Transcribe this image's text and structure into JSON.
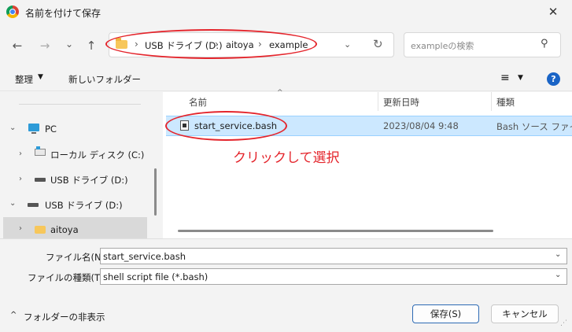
{
  "window": {
    "title": "名前を付けて保存",
    "close": "✕"
  },
  "nav": {
    "back": "←",
    "forward": "→",
    "recent": "⌄",
    "up": "↑",
    "breadcrumbs": [
      "USB ドライブ (D:)",
      "aitoya",
      "example"
    ],
    "separator": "›",
    "dropdown": "⌄",
    "refresh": "↻",
    "search_placeholder": "exampleの検索",
    "search_icon": "⚲"
  },
  "toolbar": {
    "organize": "整理",
    "caret": "▼",
    "new_folder": "新しいフォルダー",
    "view_icon": "≡",
    "help": "?"
  },
  "tree": {
    "pc": "PC",
    "local_disk": "ローカル ディスク (C:)",
    "usb1": "USB ドライブ (D:)",
    "usb2": "USB ドライブ (D:)",
    "aitoya": "aitoya",
    "collapsed": "›",
    "expanded": "⌄"
  },
  "columns": {
    "name": "名前",
    "modified": "更新日時",
    "type": "種類",
    "sort": "^"
  },
  "files": [
    {
      "name": "start_service.bash",
      "modified": "2023/08/04 9:48",
      "type": "Bash ソース ファイル"
    }
  ],
  "annotation": "クリックして選択",
  "form": {
    "filename_label": "ファイル名(N):",
    "filename_value": "start_service.bash",
    "filetype_label": "ファイルの種類(T):",
    "filetype_value": "shell script file (*.bash)",
    "caret": "⌄"
  },
  "footer": {
    "hide_folders": "フォルダーの非表示",
    "hide_caret": "^",
    "save": "保存(S)",
    "cancel": "キャンセル",
    "grip": "⋰"
  },
  "colors": {
    "annotation_red": "#e4252c",
    "selection": "#cce8ff",
    "accent": "#1a64c6"
  }
}
